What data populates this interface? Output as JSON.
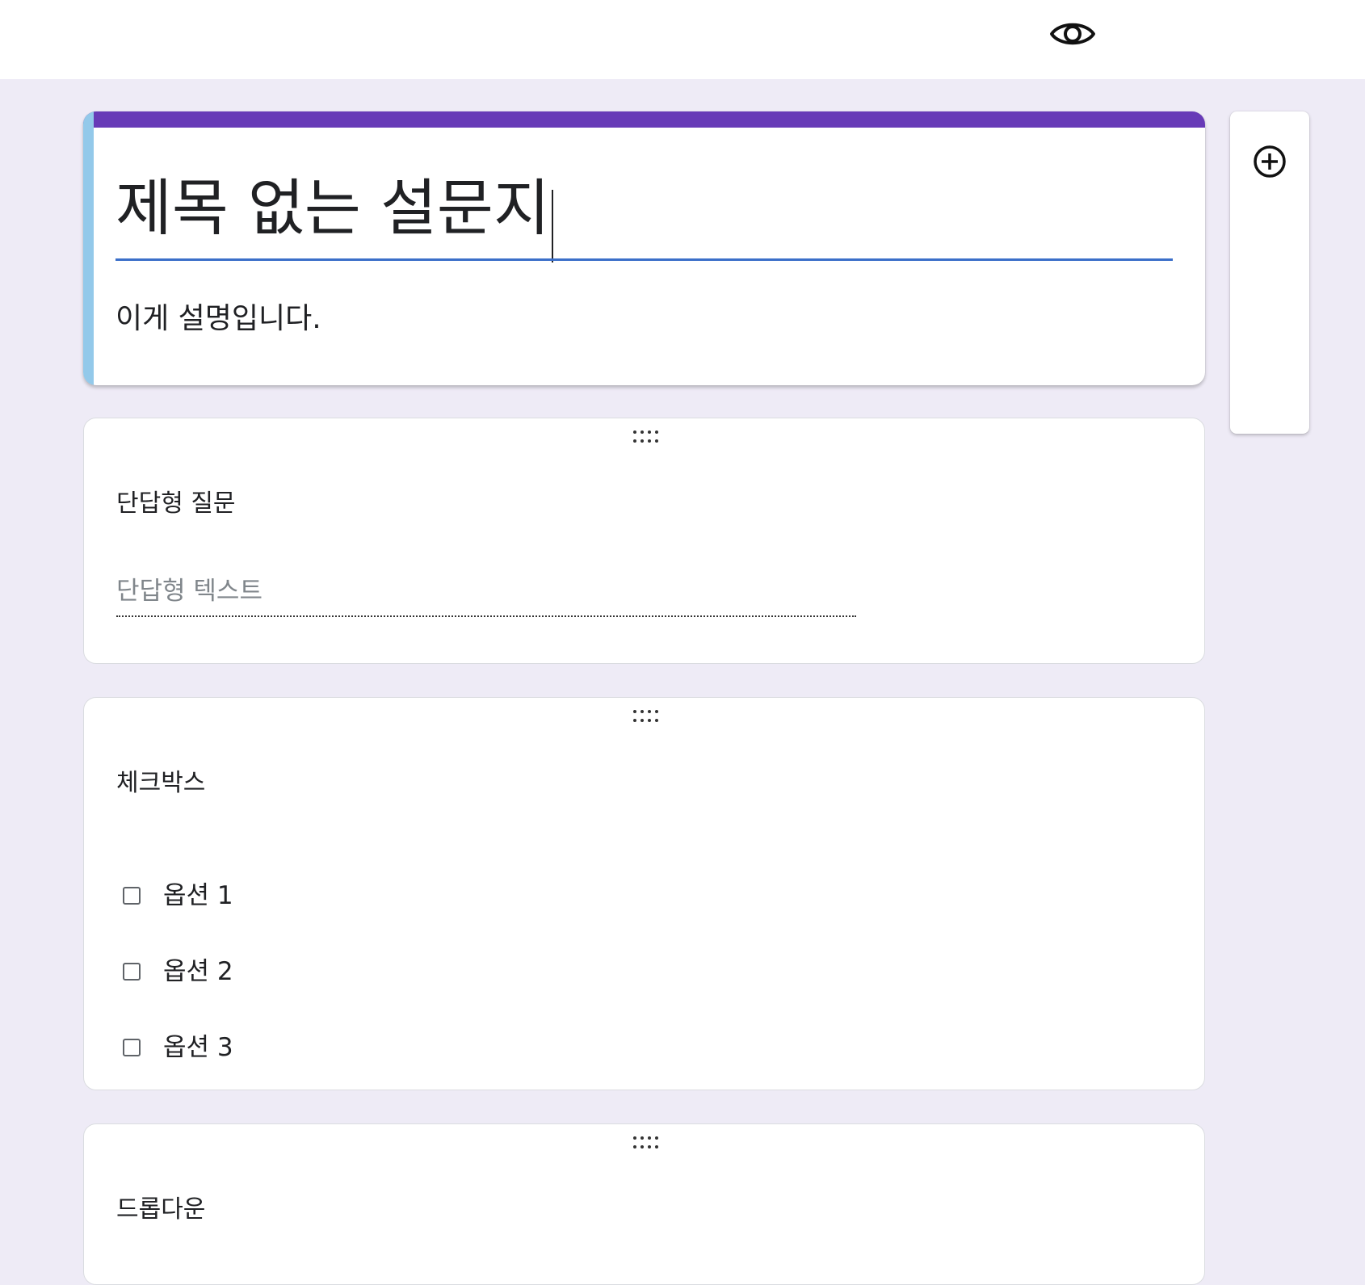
{
  "toolbar": {
    "preview_icon": "eye-icon"
  },
  "form": {
    "title": "제목 없는 설문지",
    "description": "이게 설명입니다."
  },
  "side_toolbar": {
    "add_icon": "add-circle-icon"
  },
  "questions": [
    {
      "title": "단답형 질문",
      "type": "short-answer",
      "placeholder": "단답형 텍스트"
    },
    {
      "title": "체크박스",
      "type": "checkbox",
      "options": [
        "옵션 1",
        "옵션 2",
        "옵션 3"
      ]
    },
    {
      "title": "드롭다운",
      "type": "dropdown"
    }
  ],
  "colors": {
    "theme": "#673ab7",
    "background": "#eeebf6",
    "focus_stripe": "#93c9ea",
    "title_underline": "#3b6fc9"
  }
}
